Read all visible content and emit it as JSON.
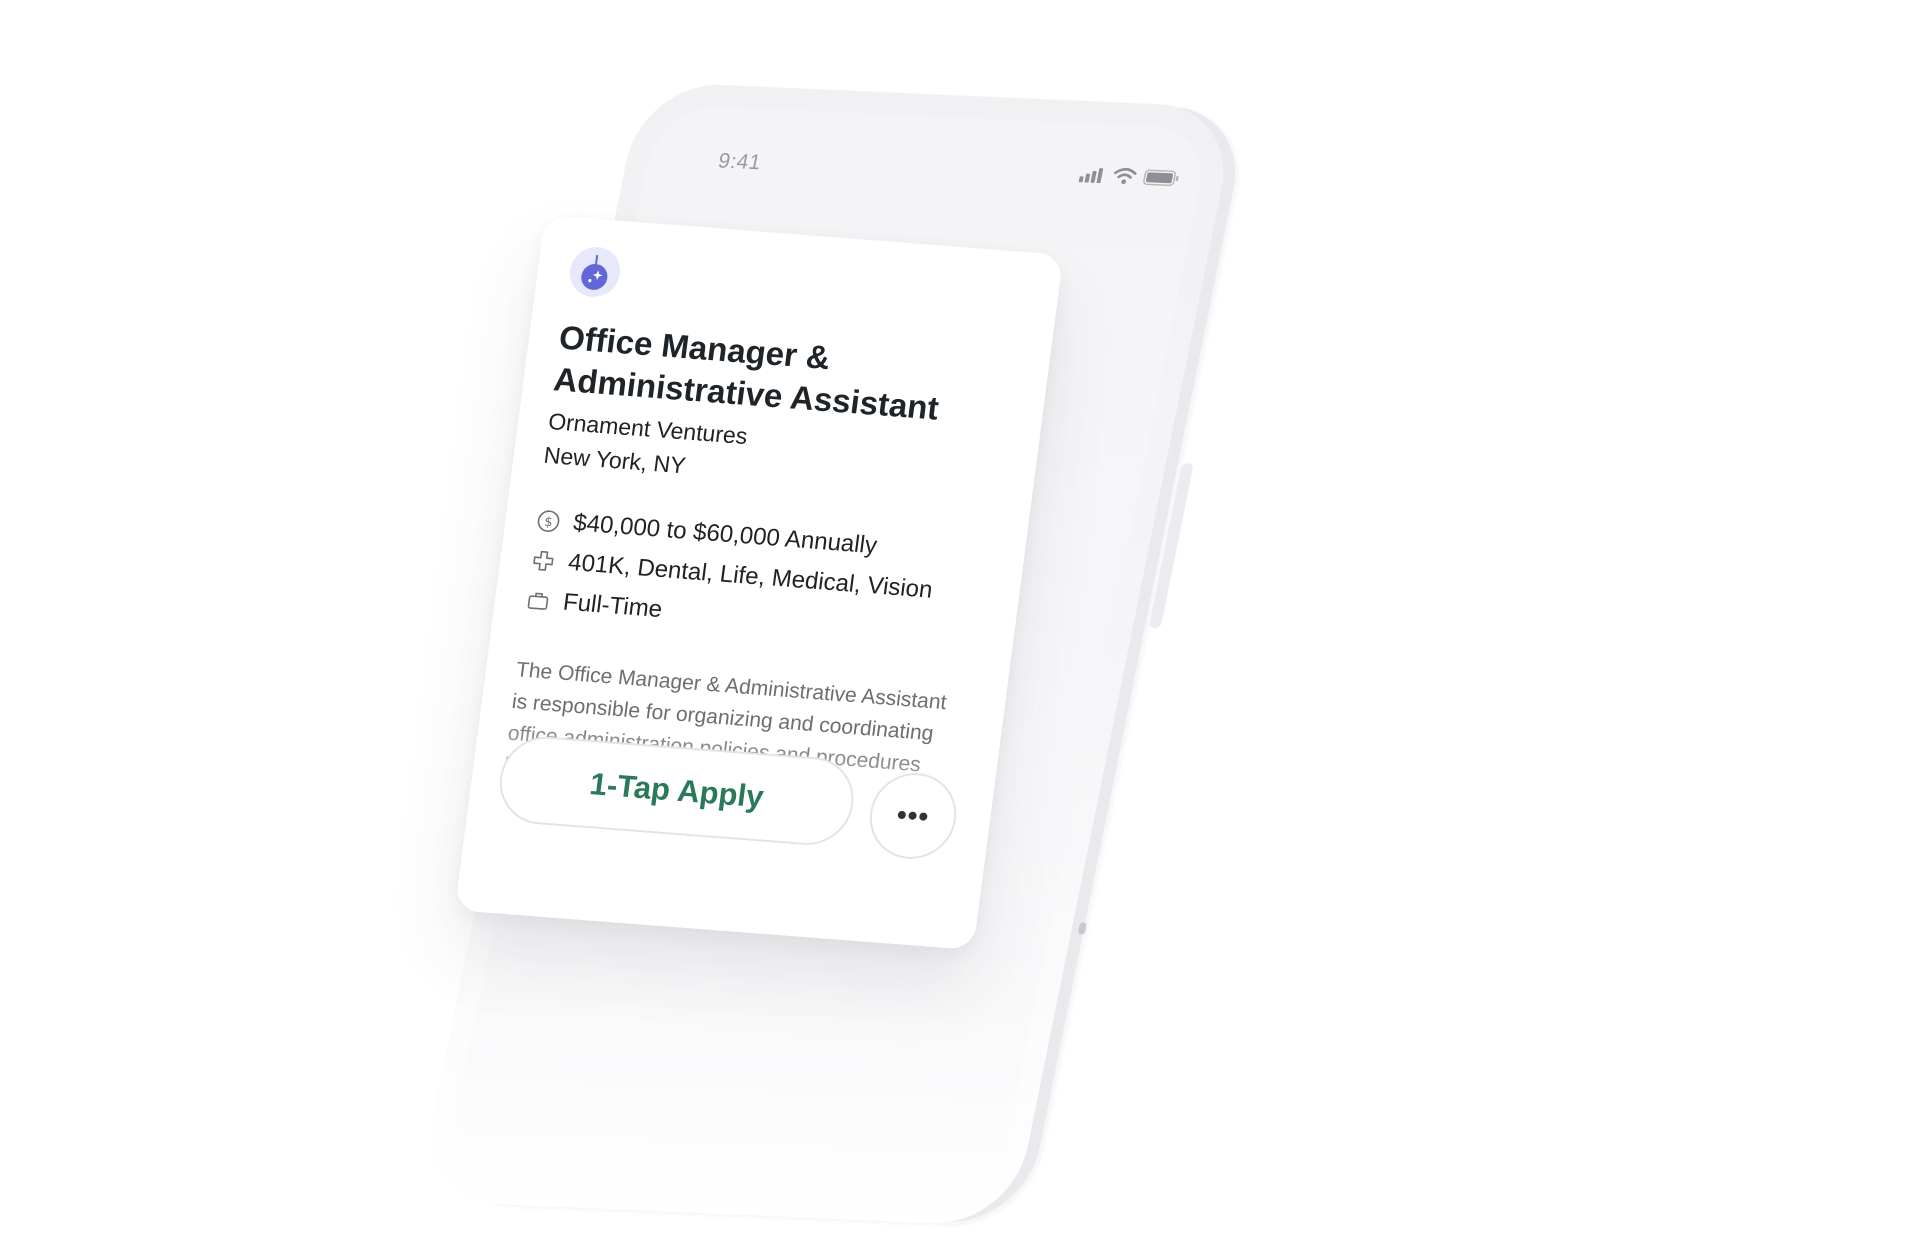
{
  "status_bar": {
    "time": "9:41",
    "icons": [
      "signal-icon",
      "wifi-icon",
      "battery-icon"
    ]
  },
  "job_card": {
    "logo_icon": "company-logo-icon",
    "title": "Office Manager & Administrative Assistant",
    "company": "Ornament Ventures",
    "location": "New York, NY",
    "facts": [
      {
        "icon": "dollar-icon",
        "text": "$40,000 to $60,000 Annually"
      },
      {
        "icon": "health-cross-icon",
        "text": "401K, Dental, Life, Medical, Vision"
      },
      {
        "icon": "briefcase-icon",
        "text": "Full-Time"
      }
    ],
    "description": "The Office Manager & Administrative Assistant is responsible for organizing and coordinating office administration policies and procedures between",
    "apply_label": "1-Tap Apply",
    "more_label": "•••"
  },
  "colors": {
    "accent_green": "#2a7a5a",
    "logo_bg": "#e8e8fb",
    "logo_fg": "#6366d6"
  }
}
